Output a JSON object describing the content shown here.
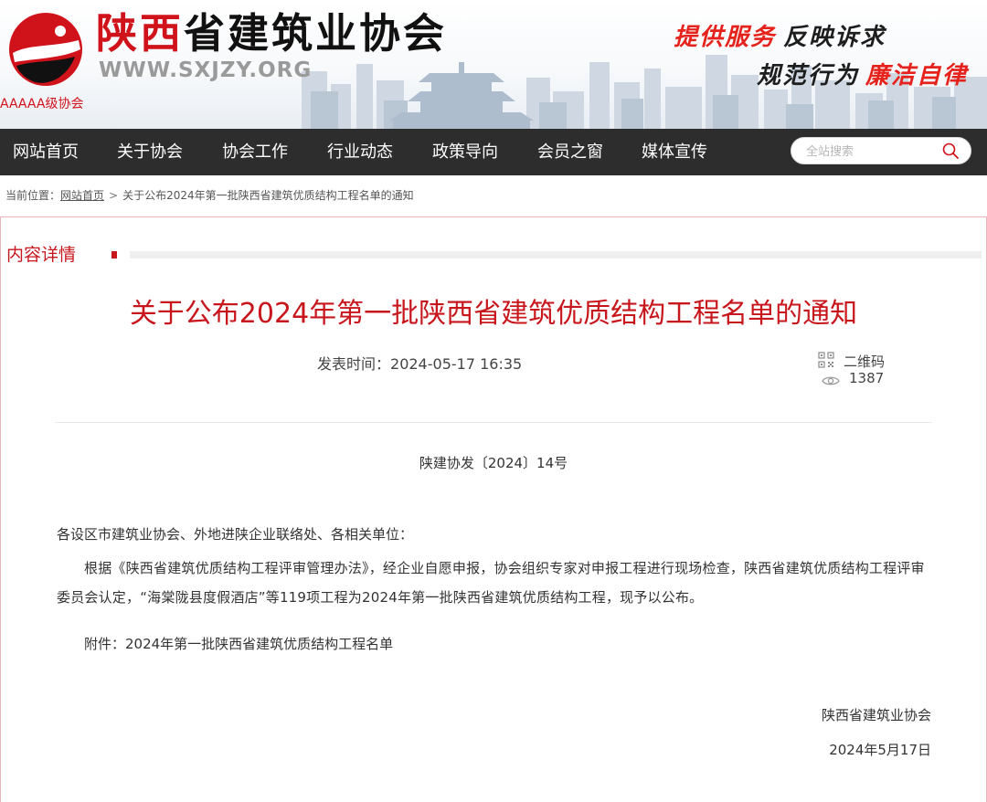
{
  "site": {
    "name_red": "陕西",
    "name_black": "省建筑业协会",
    "domain": "WWW.SXJZY.ORG",
    "level": "AAAAA级协会",
    "slogans": [
      "提供服务",
      "反映诉求",
      "规范行为",
      "廉洁自律"
    ]
  },
  "nav": {
    "items": [
      "网站首页",
      "关于协会",
      "协会工作",
      "行业动态",
      "政策导向",
      "会员之窗",
      "媒体宣传"
    ],
    "search_placeholder": "全站搜索"
  },
  "breadcrumb": {
    "label": "当前位置：",
    "home": "网站首页",
    "separator": ">",
    "current": "关于公布2024年第一批陕西省建筑优质结构工程名单的通知"
  },
  "section": {
    "title": "内容详情"
  },
  "article": {
    "title": "关于公布2024年第一批陕西省建筑优质结构工程名单的通知",
    "published_label": "发表时间：",
    "published_time": "2024-05-17 16:35",
    "qr_label": "二维码",
    "views": "1387",
    "doc_number": "陕建协发〔2024〕14号",
    "salutation": "各设区市建筑业协会、外地进陕企业联络处、各相关单位：",
    "body": "根据《陕西省建筑优质结构工程评审管理办法》，经企业自愿申报，协会组织专家对申报工程进行现场检查，陕西省建筑优质结构工程评审委员会认定，“海棠陇县度假酒店”等119项工程为2024年第一批陕西省建筑优质结构工程，现予以公布。",
    "attachment": "附件：2024年第一批陕西省建筑优质结构工程名单",
    "signature_org": "陕西省建筑业协会",
    "signature_date": "2024年5月17日"
  },
  "colors": {
    "brand_red": "#c8161d",
    "nav_bg": "#2d2d2d"
  }
}
